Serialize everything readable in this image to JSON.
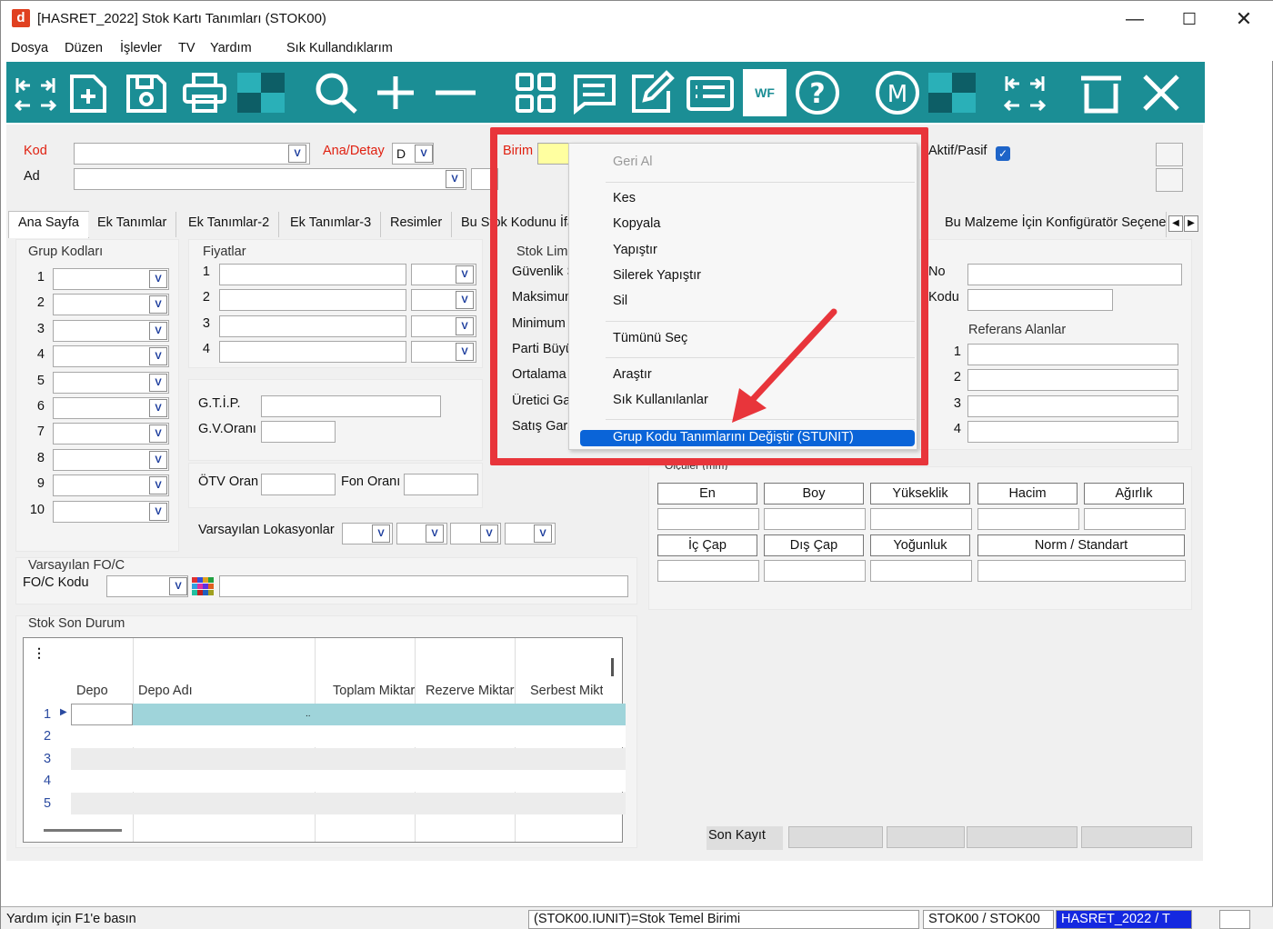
{
  "window": {
    "title": "[HASRET_2022] Stok Kartı Tanımları (STOK00)",
    "app_icon": "d"
  },
  "menu": [
    "Dosya",
    "Düzen",
    "İşlevler",
    "TV",
    "Yardım",
    "Sık Kullandıklarım"
  ],
  "toolbar": {
    "color": "#1b8e95",
    "icons": [
      "first-last-icon",
      "new-doc-icon",
      "save-icon",
      "print-icon",
      "checker-icon",
      "search-icon",
      "plus-icon",
      "minus-icon",
      "grid-icon",
      "comment-icon",
      "edit-icon",
      "list-icon",
      "wf-icon",
      "help-icon",
      "m-icon",
      "checker-icon",
      "prev-next-icon",
      "delete-icon",
      "close-icon"
    ],
    "wf_label": "WF",
    "m_label": "M",
    "help_label": "?"
  },
  "header": {
    "kod_label": "Kod",
    "ad_label": "Ad",
    "ana_detay_label": "Ana/Detay",
    "ana_detay_value": "D",
    "birim_label": "Birim",
    "aktif_pasif_label": "Aktif/Pasif",
    "aktif_checked": true
  },
  "tabs": [
    "Ana Sayfa",
    "Ek Tanımlar",
    "Ek Tanımlar-2",
    "Ek Tanımlar-3",
    "Resimler",
    "Bu Stok Kodunu İfa",
    "Bu Malzeme İçin Konfigüratör Seçenekl"
  ],
  "grup_kodlari": {
    "title": "Grup Kodları",
    "rows": [
      "1",
      "2",
      "3",
      "4",
      "5",
      "6",
      "7",
      "8",
      "9",
      "10"
    ]
  },
  "fiyatlar": {
    "title": "Fiyatlar",
    "rows": [
      "1",
      "2",
      "3",
      "4"
    ]
  },
  "gtip_label": "G.T.İ.P.",
  "gv_label": "G.V.Oranı",
  "otv_label": "ÖTV Oran",
  "fon_label": "Fon Oranı",
  "varsayilan_lokasyonlar_label": "Varsayılan Lokasyonlar",
  "stok_limit": {
    "title": "Stok Limi",
    "labels": [
      "Güvenlik S",
      "Maksimum",
      "Minimum S",
      "Parti Büyü",
      "Ortalama T",
      "Üretici Ga",
      "Satış Gara"
    ]
  },
  "referans": {
    "no_label": "No",
    "kodu_label": "Kodu",
    "title": "Referans Alanlar",
    "rows": [
      "1",
      "2",
      "3",
      "4"
    ]
  },
  "olculer": {
    "title": "Ölçüler (mm)",
    "row1": [
      "En",
      "Boy",
      "Yükseklik",
      "Hacim",
      "Ağırlık"
    ],
    "row2": [
      "İç Çap",
      "Dış Çap",
      "Yoğunluk",
      "Norm / Standart"
    ]
  },
  "foc": {
    "title": "Varsayılan FO/C",
    "label": "FO/C Kodu"
  },
  "stok_son_durum": {
    "title": "Stok Son Durum",
    "columns": [
      "Depo",
      "Depo Adı",
      "Toplam Miktar",
      "Rezerve Miktar",
      "Serbest Mikta"
    ],
    "rows": [
      "1",
      "2",
      "3",
      "4",
      "5"
    ],
    "ellipsis": ".."
  },
  "son_kayit_label": "Son Kayıt",
  "context_menu": {
    "items": [
      "Geri Al",
      "Kes",
      "Kopyala",
      "Yapıştır",
      "Silerek Yapıştır",
      "Sil",
      "Tümünü Seç",
      "Araştır",
      "Sık Kullanılanlar",
      "Grup Kodu Tanımlarını Değiştir (STUNIT)"
    ],
    "disabled": [
      "Geri Al"
    ],
    "highlighted": "Grup Kodu Tanımlarını Değiştir (STUNIT)",
    "highlight_color": "#0a64d8"
  },
  "annotation_color": "#e8353b",
  "status": {
    "help": "Yardım için F1'e basın",
    "field": "(STOK00.IUNIT)=Stok Temel Birimi",
    "table": "STOK00 / STOK00",
    "db": "HASRET_2022 / T"
  }
}
